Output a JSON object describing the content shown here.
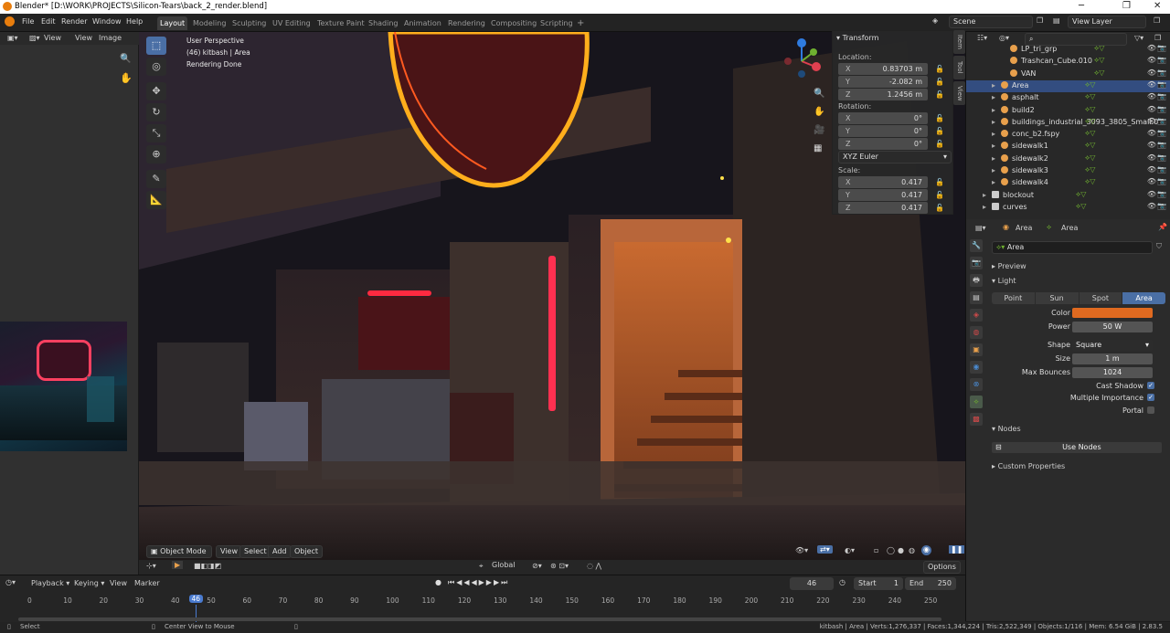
{
  "window": {
    "title": "Blender* [D:\\WORK\\PROJECTS\\Silicon-Tears\\back_2_render.blend]",
    "minimize": "─",
    "maximize": "❐",
    "close": "✕"
  },
  "menu": [
    "File",
    "Edit",
    "Render",
    "Window",
    "Help"
  ],
  "workspaces": [
    "Layout",
    "Modeling",
    "Sculpting",
    "UV Editing",
    "Texture Paint",
    "Shading",
    "Animation",
    "Rendering",
    "Compositing",
    "Scripting",
    "+"
  ],
  "scene": {
    "name": "Scene",
    "view_layer": "View Layer"
  },
  "image_editor": {
    "view": "View",
    "view2": "View",
    "image": "Image"
  },
  "viewport": {
    "perspective": "User Perspective",
    "collection": "(46) kitbash | Area",
    "status": "Rendering Done"
  },
  "transform": {
    "title": "Transform",
    "location_label": "Location:",
    "rotation_label": "Rotation:",
    "scale_label": "Scale:",
    "rot_mode": "XYZ Euler",
    "location": [
      {
        "axis": "X",
        "value": "0.83703 m"
      },
      {
        "axis": "Y",
        "value": "-2.082 m"
      },
      {
        "axis": "Z",
        "value": "1.2456 m"
      }
    ],
    "rotation": [
      {
        "axis": "X",
        "value": "0°"
      },
      {
        "axis": "Y",
        "value": "0°"
      },
      {
        "axis": "Z",
        "value": "0°"
      }
    ],
    "scale": [
      {
        "axis": "X",
        "value": "0.417"
      },
      {
        "axis": "Y",
        "value": "0.417"
      },
      {
        "axis": "Z",
        "value": "0.417"
      }
    ]
  },
  "side_tabs": [
    "Item",
    "Tool",
    "View"
  ],
  "viewport_header": {
    "mode": "Object Mode",
    "view": "View",
    "select": "Select",
    "add": "Add",
    "object": "Object",
    "options": "Options",
    "orientation": "Global"
  },
  "outliner": [
    {
      "name": "LP_tri_grp",
      "indent": 3,
      "color": "#e8a04c"
    },
    {
      "name": "Trashcan_Cube.010",
      "indent": 3,
      "color": "#e8a04c"
    },
    {
      "name": "VAN",
      "indent": 3,
      "color": "#e8a04c"
    },
    {
      "name": "Area",
      "indent": 2,
      "color": "#e8a04c",
      "selected": true
    },
    {
      "name": "asphalt",
      "indent": 2,
      "color": "#e8a04c"
    },
    {
      "name": "build2",
      "indent": 2,
      "color": "#e8a04c"
    },
    {
      "name": "buildings_industrial_3093_3805_Small.0",
      "indent": 2,
      "color": "#e8a04c"
    },
    {
      "name": "conc_b2.fspy",
      "indent": 2,
      "color": "#e8a04c"
    },
    {
      "name": "sidewalk1",
      "indent": 2,
      "color": "#e8a04c"
    },
    {
      "name": "sidewalk2",
      "indent": 2,
      "color": "#e8a04c"
    },
    {
      "name": "sidewalk3",
      "indent": 2,
      "color": "#e8a04c"
    },
    {
      "name": "sidewalk4",
      "indent": 2,
      "color": "#e8a04c"
    },
    {
      "name": "blockout",
      "indent": 1,
      "color": "#cccccc"
    },
    {
      "name": "curves",
      "indent": 1,
      "color": "#cccccc"
    }
  ],
  "properties": {
    "object": "Area",
    "data": "Area",
    "data_field": "Area",
    "preview": "Preview",
    "light": "Light",
    "light_types": [
      "Point",
      "Sun",
      "Spot",
      "Area"
    ],
    "active_type": "Area",
    "color_label": "Color",
    "color": "#e06a20",
    "power_label": "Power",
    "power": "50 W",
    "shape_label": "Shape",
    "shape": "Square",
    "size_label": "Size",
    "size": "1 m",
    "bounces_label": "Max Bounces",
    "bounces": "1024",
    "cast_shadow": "Cast Shadow",
    "multiple_importance": "Multiple Importance",
    "portal": "Portal",
    "nodes": "Nodes",
    "use_nodes": "Use Nodes",
    "custom_properties": "Custom Properties"
  },
  "timeline": {
    "playback": "Playback",
    "keying": "Keying",
    "view": "View",
    "marker": "Marker",
    "current": "46",
    "start_label": "Start",
    "start": "1",
    "end_label": "End",
    "end": "250",
    "ticks": [
      "0",
      "10",
      "20",
      "30",
      "40",
      "50",
      "60",
      "70",
      "80",
      "90",
      "100",
      "110",
      "120",
      "130",
      "140",
      "150",
      "160",
      "170",
      "180",
      "190",
      "200",
      "210",
      "220",
      "230",
      "240",
      "250"
    ]
  },
  "status": {
    "select": "Select",
    "center": "Center View to Mouse",
    "info": "kitbash | Area | Verts:1,276,337 | Faces:1,344,224 | Tris:2,522,349 | Objects:1/116 | Mem: 6.54 GiB | 2.83.5"
  }
}
